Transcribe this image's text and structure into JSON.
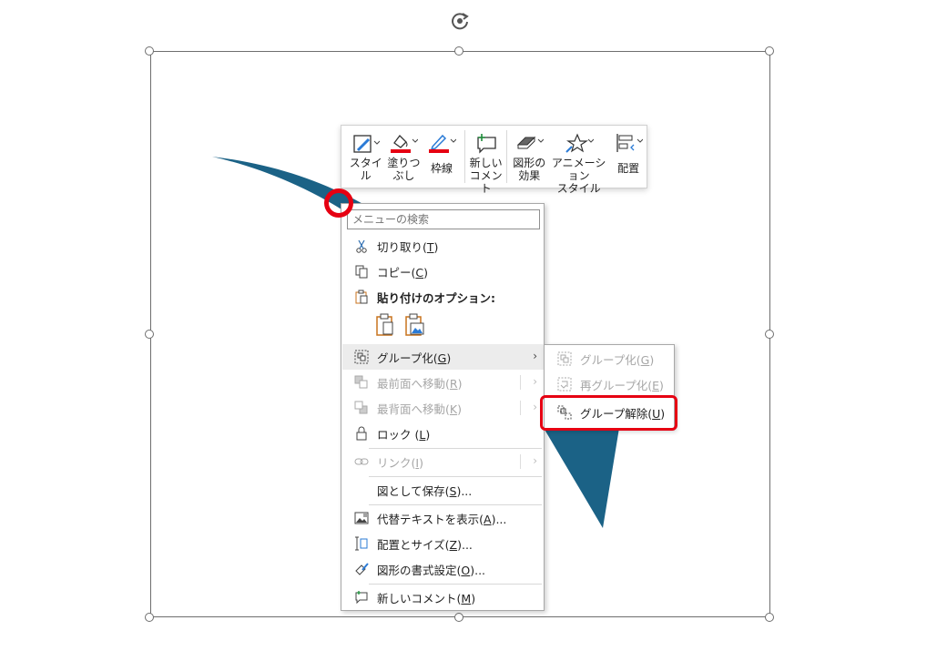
{
  "mini_toolbar": {
    "buttons": [
      {
        "label": "スタイ\nル"
      },
      {
        "label": "塗りつ\nぶし"
      },
      {
        "label": "枠線"
      },
      {
        "label": "新しい\nコメント"
      },
      {
        "label": "図形の\n効果"
      },
      {
        "label": "アニメーション\nスタイル"
      },
      {
        "label": "配置"
      }
    ],
    "fill_color": "#e60012",
    "line_color": "#e60012"
  },
  "context_menu": {
    "search_placeholder": "メニューの検索",
    "items": {
      "cut": {
        "label": "切り取り(",
        "acc": "T",
        "end": ")"
      },
      "copy": {
        "label": "コピー(",
        "acc": "C",
        "end": ")"
      },
      "paste_options": {
        "label": "貼り付けのオプション:"
      },
      "group": {
        "label": "グループ化(",
        "acc": "G",
        "end": ")"
      },
      "bring_front": {
        "label": "最前面へ移動(",
        "acc": "R",
        "end": ")"
      },
      "send_back": {
        "label": "最背面へ移動(",
        "acc": "K",
        "end": ")"
      },
      "lock": {
        "label": "ロック (",
        "acc": "L",
        "end": ")"
      },
      "link": {
        "label": "リンク(",
        "acc": "I",
        "end": ")"
      },
      "save_as_picture": {
        "label": "図として保存(",
        "acc": "S",
        "end": ")..."
      },
      "alt_text": {
        "label": "代替テキストを表示(",
        "acc": "A",
        "end": ")..."
      },
      "size_position": {
        "label": "配置とサイズ(",
        "acc": "Z",
        "end": ")..."
      },
      "format_shape": {
        "label": "図形の書式設定(",
        "acc": "O",
        "end": ")..."
      },
      "new_comment": {
        "label": "新しいコメント(",
        "acc": "M",
        "end": ")"
      }
    }
  },
  "submenu": {
    "items": {
      "group": {
        "label": "グループ化(",
        "acc": "G",
        "end": ")"
      },
      "regroup": {
        "label": "再グループ化(",
        "acc": "E",
        "end": ")"
      },
      "ungroup": {
        "label": "グループ解除(",
        "acc": "U",
        "end": ")"
      }
    }
  },
  "colors": {
    "shape_fill": "#1b6286",
    "highlight": "#e60012",
    "hover_bg": "#ececec"
  }
}
